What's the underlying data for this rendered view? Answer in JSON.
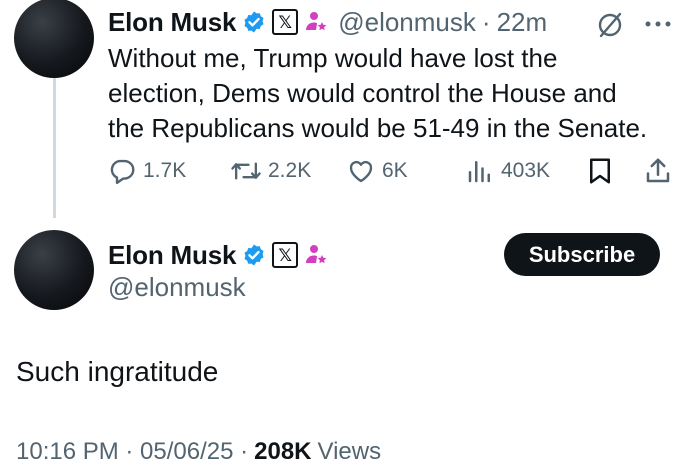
{
  "reply": {
    "author_name": "Elon Musk",
    "handle": "@elonmusk",
    "separator": "·",
    "time_ago": "22m",
    "text_lines": [
      "Without me, Trump would have lost the",
      "election, Dems would control the House and",
      "the Republicans would be 51-49 in the Senate."
    ],
    "actions": {
      "replies": "1.7K",
      "reposts": "2.2K",
      "likes": "6K",
      "views": "403K"
    }
  },
  "main": {
    "author_name": "Elon Musk",
    "handle": "@elonmusk",
    "subscribe_label": "Subscribe",
    "text": "Such ingratitude",
    "timestamp": "10:16 PM · 05/06/25 ·",
    "views_count": "208K",
    "views_label": "Views"
  },
  "colors": {
    "verified_blue": "#1d9bf0",
    "text": "#0f1419",
    "secondary": "#536471",
    "affiliate_pink": "#d43fc0"
  },
  "icons": [
    "verified-icon",
    "x-affiliate-icon",
    "person-star-icon",
    "grok-icon",
    "more-icon",
    "reply-icon",
    "repost-icon",
    "like-icon",
    "views-icon",
    "bookmark-icon",
    "share-icon"
  ]
}
